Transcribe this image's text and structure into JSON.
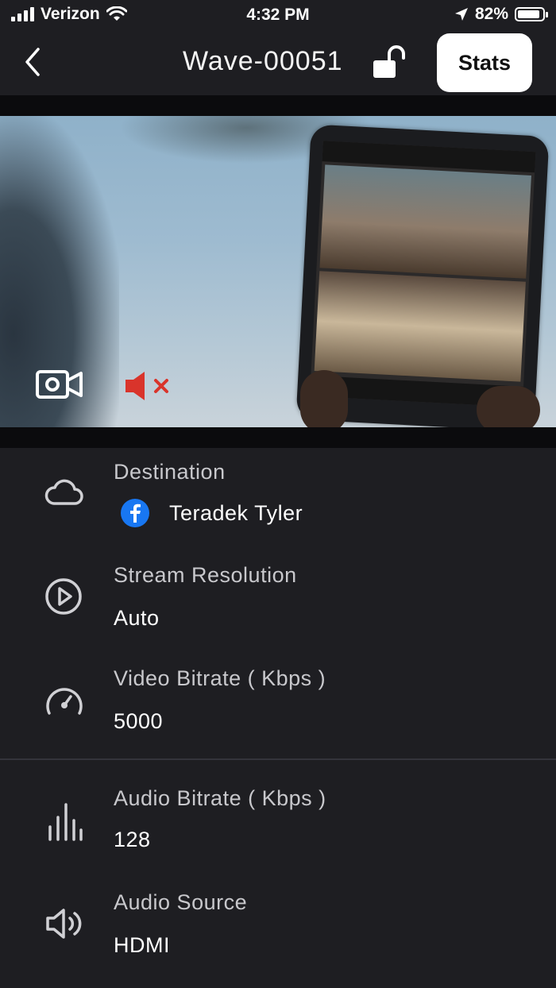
{
  "status_bar": {
    "carrier": "Verizon",
    "time": "4:32 PM",
    "battery": "82%"
  },
  "nav": {
    "title": "Wave-00051",
    "stats_label": "Stats"
  },
  "settings": [
    {
      "label": "Destination",
      "value": "Teradek Tyler",
      "icon": "cloud-icon"
    },
    {
      "label": "Stream Resolution",
      "value": "Auto",
      "icon": "play-circle-icon"
    },
    {
      "label": "Video Bitrate ( Kbps )",
      "value": "5000",
      "icon": "speedometer-icon"
    },
    {
      "label": "Audio Bitrate ( Kbps )",
      "value": "128",
      "icon": "audio-bars-icon"
    },
    {
      "label": "Audio Source",
      "value": "HDMI",
      "icon": "speaker-icon"
    }
  ],
  "colors": {
    "background": "#1e1e22",
    "mute_red": "#d9342b",
    "facebook_blue": "#1877f2"
  }
}
